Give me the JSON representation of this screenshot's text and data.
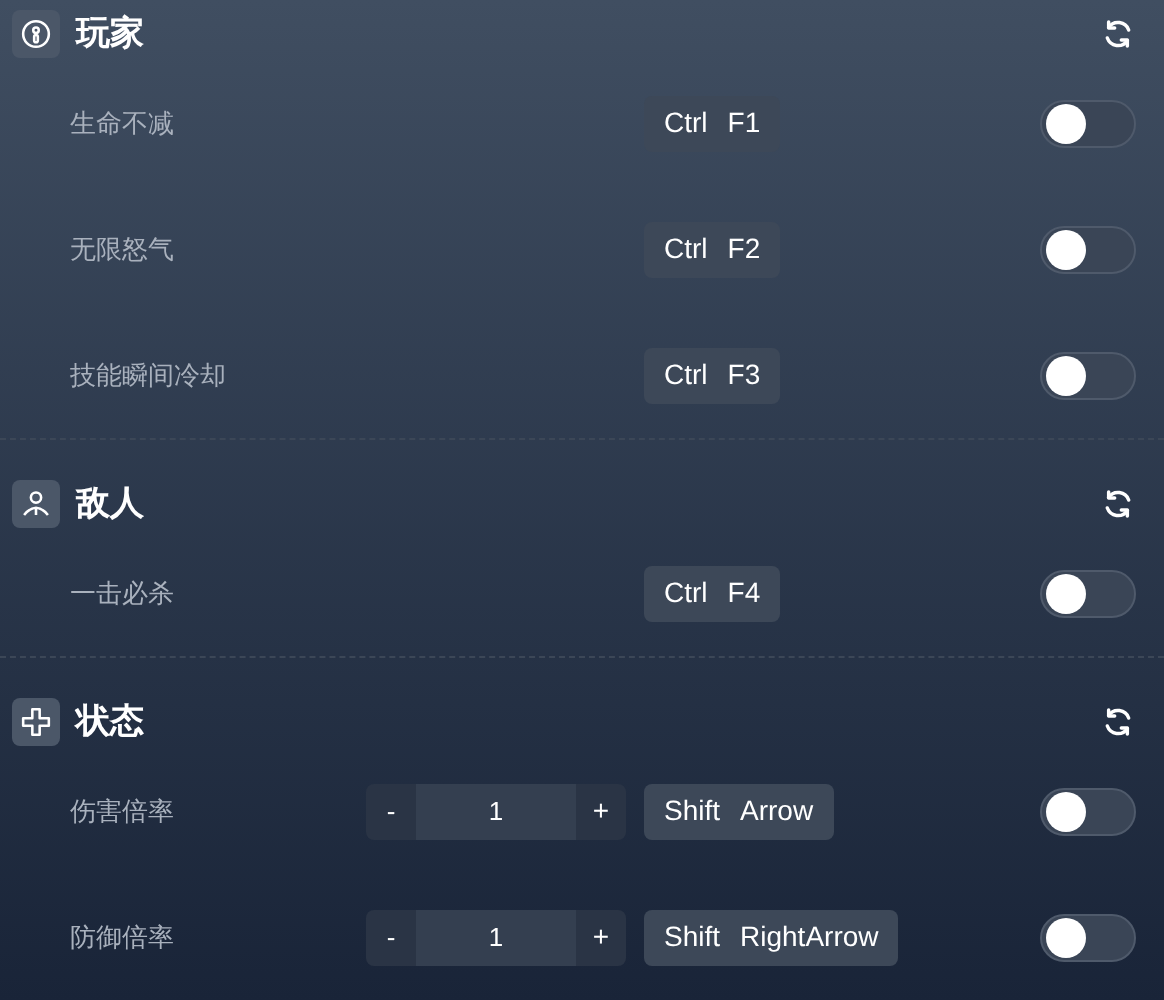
{
  "sections": [
    {
      "title": "玩家",
      "kind": "player",
      "rows": [
        {
          "label": "生命不减",
          "kind": "toggle",
          "keys": [
            "Ctrl",
            "F1"
          ],
          "on": false
        },
        {
          "label": "无限怒气",
          "kind": "toggle",
          "keys": [
            "Ctrl",
            "F2"
          ],
          "on": false
        },
        {
          "label": "技能瞬间冷却",
          "kind": "toggle",
          "keys": [
            "Ctrl",
            "F3"
          ],
          "on": false
        }
      ]
    },
    {
      "title": "敌人",
      "kind": "enemy",
      "rows": [
        {
          "label": "一击必杀",
          "kind": "toggle",
          "keys": [
            "Ctrl",
            "F4"
          ],
          "on": false
        }
      ]
    },
    {
      "title": "状态",
      "kind": "status",
      "rows": [
        {
          "label": "伤害倍率",
          "kind": "stepper",
          "decrement": "-",
          "value": "1",
          "increment": "+",
          "keys": [
            "Shift",
            "Arrow"
          ],
          "on": false
        },
        {
          "label": "防御倍率",
          "kind": "stepper",
          "decrement": "-",
          "value": "1",
          "increment": "+",
          "keys": [
            "Shift",
            "RightArrow"
          ],
          "on": false
        }
      ]
    }
  ]
}
